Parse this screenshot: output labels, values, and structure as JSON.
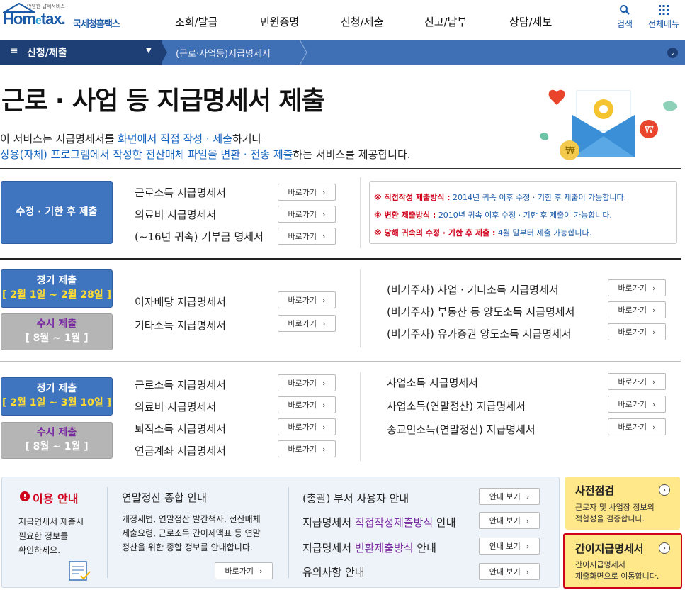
{
  "header": {
    "logo_small": "안녕한 납세서비스",
    "logo_main_a": "Hom",
    "logo_main_e": "e",
    "logo_main_b": "tax.",
    "logo_sub": "국세청홈택스",
    "nav": [
      "조회/발급",
      "민원증명",
      "신청/제출",
      "신고/납부",
      "상담/제보"
    ],
    "search_label": "검색",
    "menu_label": "전체메뉴"
  },
  "breadcrumb": {
    "menu": "신청/제출",
    "current": "(근로·사업등)지급명세서"
  },
  "page": {
    "title": "근로 · 사업 등 지급명세서 제출",
    "intro1_a": "이 서비스는 지급명세서를 ",
    "intro1_b": "화면에서 직접 작성 · 제출",
    "intro1_c": "하거나",
    "intro2_a": "상용(자체) 프로그램에서 작성한 전산매체 파일을 변환 · 전송 제출",
    "intro2_b": "하는 서비스를 제공합니다."
  },
  "button_label": "바로가기",
  "section1": {
    "box": "수정 · 기한 후 제출",
    "items": [
      "근로소득 지급명세서",
      "의료비 지급명세서",
      "(~16년 귀속) 기부금 명세서"
    ],
    "notice": [
      {
        "label": "※ 직접작성 제출방식 :",
        "text": "2014년 귀속 이후 수정 · 기한 후 제출이 가능합니다."
      },
      {
        "label": "※ 변환 제출방식 :",
        "text": "2010년 귀속 이후 수정 · 기한 후 제출이 가능합니다."
      },
      {
        "label": "※ 당해 귀속의 수정 · 기한 후 제출 :",
        "text": "4월 말부터 제출 가능합니다."
      }
    ]
  },
  "section2": {
    "regular_title": "정기 제출",
    "regular_period": "[ 2월 1일 ~ 2월 28일 ]",
    "occasional_title": "수시 제출",
    "occasional_period": "[ 8월 ~ 1월 ]",
    "left_items": [
      "이자배당 지급명세서",
      "기타소득 지급명세서"
    ],
    "right_items": [
      "(비거주자) 사업 · 기타소득 지급명세서",
      "(비거주자) 부동산 등 양도소득 지급명세서",
      "(비거주자) 유가증권 양도소득 지급명세서"
    ]
  },
  "section3": {
    "regular_title": "정기 제출",
    "regular_period": "[ 2월 1일 ~ 3월 10일 ]",
    "occasional_title": "수시 제출",
    "occasional_period": "[ 8월 ~ 1월 ]",
    "left_items": [
      "근로소득 지급명세서",
      "의료비 지급명세서",
      "퇴직소득 지급명세서",
      "연금계좌 지급명세서"
    ],
    "right_items": [
      "사업소득 지급명세서",
      "사업소득(연말정산) 지급명세서",
      "종교인소득(연말정산) 지급명세서"
    ]
  },
  "info": {
    "usage_title": "이용 안내",
    "usage_text": [
      "지급명세서 제출시",
      "필요한 정보를",
      "확인하세요."
    ],
    "yearend_title": "연말정산 종합 안내",
    "yearend_text": [
      "개정세법, 연말정산 발간책자, 전산매체",
      "제출요령, 근로소득 간이세액표 등 연말",
      "정산을 위한 종합 정보를 안내합니다."
    ],
    "guide_button": "안내 보기",
    "guides": [
      {
        "a": "(총괄) 부서 사용자 안내",
        "b": "",
        "c": ""
      },
      {
        "a": "지급명세서 ",
        "b": "직접작성제출방식",
        "c": " 안내"
      },
      {
        "a": "지급명세서 ",
        "b": "변환제출방식",
        "c": " 안내"
      },
      {
        "a": "유의사항 안내",
        "b": "",
        "c": ""
      }
    ]
  },
  "side": {
    "precheck_title": "사전점검",
    "precheck_text": [
      "근로자 및 사업장 정보의",
      "적합성을 검증합니다."
    ],
    "simple_title": "간이지급명세서",
    "simple_text": [
      "간이지급명세서",
      "제출화면으로 이동합니다."
    ]
  },
  "colors": {
    "nav_bar": "#3f6fb4",
    "nav_dark": "#1d3f75",
    "box_blue": "#3f74bf",
    "highlight": "#d0021b",
    "yellow_panel": "#ffe88a"
  }
}
